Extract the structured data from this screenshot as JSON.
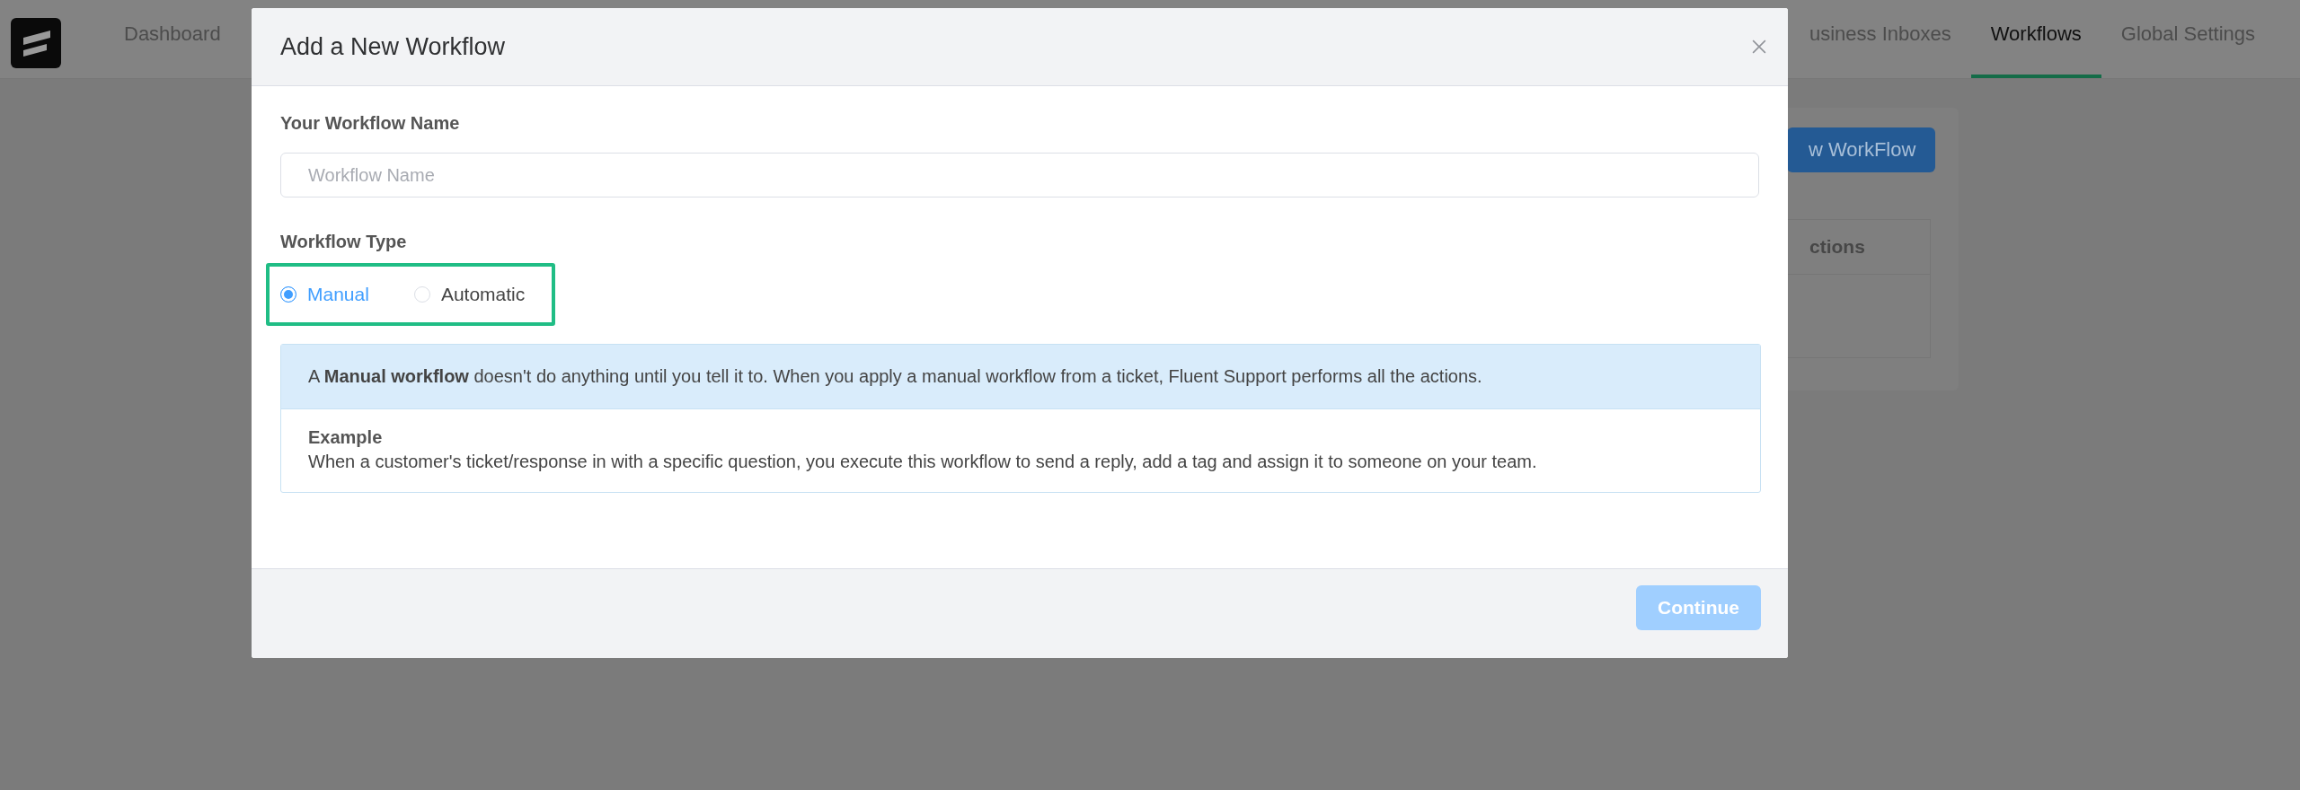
{
  "nav": {
    "tabs": [
      {
        "label": "Dashboard",
        "selected": false
      },
      {
        "label": "usiness Inboxes",
        "selected": false
      },
      {
        "label": "Workflows",
        "selected": true
      },
      {
        "label": "Global Settings",
        "selected": false
      }
    ]
  },
  "background": {
    "button": "w WorkFlow",
    "table_header": "ctions"
  },
  "modal": {
    "title": "Add a New Workflow",
    "name_label": "Your Workflow Name",
    "name_field": {
      "placeholder": "Workflow Name"
    },
    "type_label": "Workflow Type",
    "types": [
      {
        "label": "Manual",
        "selected": true
      },
      {
        "label": "Automatic",
        "selected": false
      }
    ],
    "description": "A **Manual workflow** doesn't do anything until you tell it to. When you apply a manual workflow from a ticket, Fluent Support performs all the actions.",
    "example": {
      "title": "Example",
      "text": "When a customer's ticket/response in with a specific question, you execute this workflow to send a reply, add a tag and assign it to someone on your team."
    },
    "continue_button": {
      "label": "Continue",
      "disabled": true
    }
  }
}
